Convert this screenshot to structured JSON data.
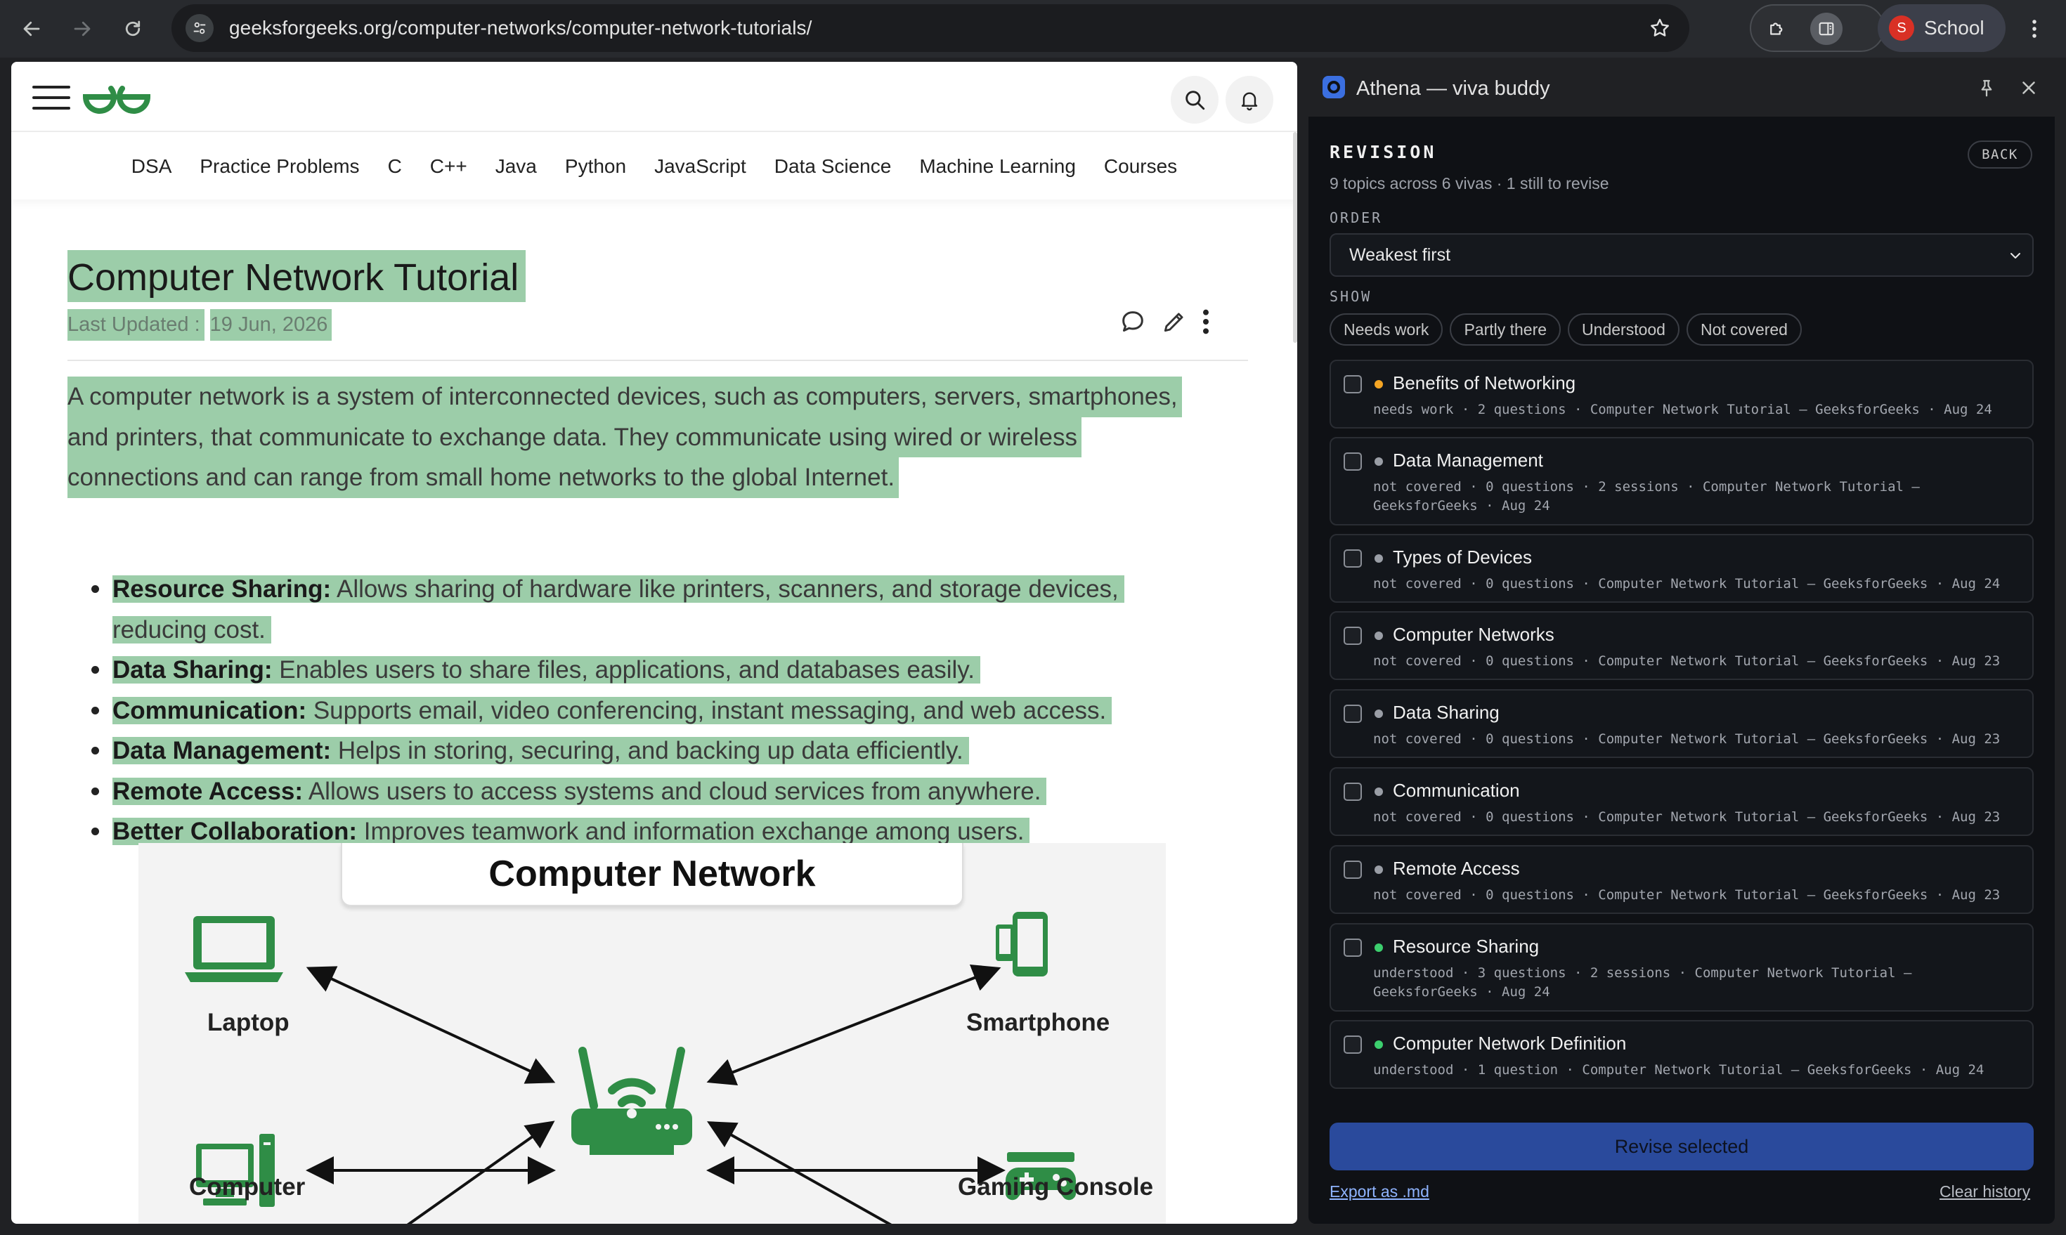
{
  "browser": {
    "url": "geeksforgeeks.org/computer-networks/computer-network-tutorials/",
    "profile_initial": "S",
    "profile_name": "School"
  },
  "site": {
    "nav": [
      "DSA",
      "Practice Problems",
      "C",
      "C++",
      "Java",
      "Python",
      "JavaScript",
      "Data Science",
      "Machine Learning",
      "Courses"
    ]
  },
  "article": {
    "title": "Computer Network Tutorial",
    "updated_label": "Last Updated :",
    "updated_date": "19 Jun, 2026",
    "intro_lines": [
      "A computer network is a system of interconnected devices, such as computers, servers, smartphones,",
      "and printers, that communicate to exchange data. They communicate using wired or wireless",
      "connections and can range from small home networks to the global Internet."
    ],
    "bullets": [
      {
        "term": "Resource Sharing:",
        "text": " Allows sharing of hardware like printers, scanners, and storage devices,",
        "cont": "reducing cost."
      },
      {
        "term": "Data Sharing:",
        "text": " Enables users to share files, applications, and databases easily."
      },
      {
        "term": "Communication:",
        "text": " Supports email, video conferencing, instant messaging, and web access."
      },
      {
        "term": "Data Management:",
        "text": " Helps in storing, securing, and backing up data efficiently."
      },
      {
        "term": "Remote Access:",
        "text": " Allows users to access systems and cloud services from anywhere."
      },
      {
        "term": "Better Collaboration:",
        "text": " Improves teamwork and information exchange among users."
      }
    ],
    "diagram": {
      "title": "Computer Network",
      "laptop": "Laptop",
      "smartphone": "Smartphone",
      "computer": "Computer",
      "gaming": "Gaming Console"
    }
  },
  "panel": {
    "title": "Athena — viva buddy",
    "heading": "REVISION",
    "back": "BACK",
    "subtitle": "9 topics across 6 vivas · 1 still to revise",
    "order_label": "ORDER",
    "order_value": "Weakest first",
    "show_label": "SHOW",
    "filters": [
      "Needs work",
      "Partly there",
      "Understood",
      "Not covered"
    ],
    "status_colors": {
      "needs work": "#f5a524",
      "not covered": "#9a9ea6",
      "understood": "#3ccf6e"
    },
    "topics": [
      {
        "name": "Benefits of Networking",
        "status": "needs work",
        "meta": "needs work · 2 questions · Computer Network Tutorial – GeeksforGeeks · Aug 24"
      },
      {
        "name": "Data Management",
        "status": "not covered",
        "meta": "not covered · 0 questions · 2 sessions · Computer Network Tutorial – GeeksforGeeks · Aug 24"
      },
      {
        "name": "Types of Devices",
        "status": "not covered",
        "meta": "not covered · 0 questions · Computer Network Tutorial – GeeksforGeeks · Aug 24"
      },
      {
        "name": "Computer Networks",
        "status": "not covered",
        "meta": "not covered · 0 questions · Computer Network Tutorial – GeeksforGeeks · Aug 23"
      },
      {
        "name": "Data Sharing",
        "status": "not covered",
        "meta": "not covered · 0 questions · Computer Network Tutorial – GeeksforGeeks · Aug 23"
      },
      {
        "name": "Communication",
        "status": "not covered",
        "meta": "not covered · 0 questions · Computer Network Tutorial – GeeksforGeeks · Aug 23"
      },
      {
        "name": "Remote Access",
        "status": "not covered",
        "meta": "not covered · 0 questions · Computer Network Tutorial – GeeksforGeeks · Aug 23"
      },
      {
        "name": "Resource Sharing",
        "status": "understood",
        "meta": "understood · 3 questions · 2 sessions · Computer Network Tutorial – GeeksforGeeks · Aug 24"
      },
      {
        "name": "Computer Network Definition",
        "status": "understood",
        "meta": "understood · 1 question · Computer Network Tutorial – GeeksforGeeks · Aug 24"
      }
    ],
    "revise_label": "Revise selected",
    "export_label": "Export as .md",
    "clear_label": "Clear history"
  }
}
